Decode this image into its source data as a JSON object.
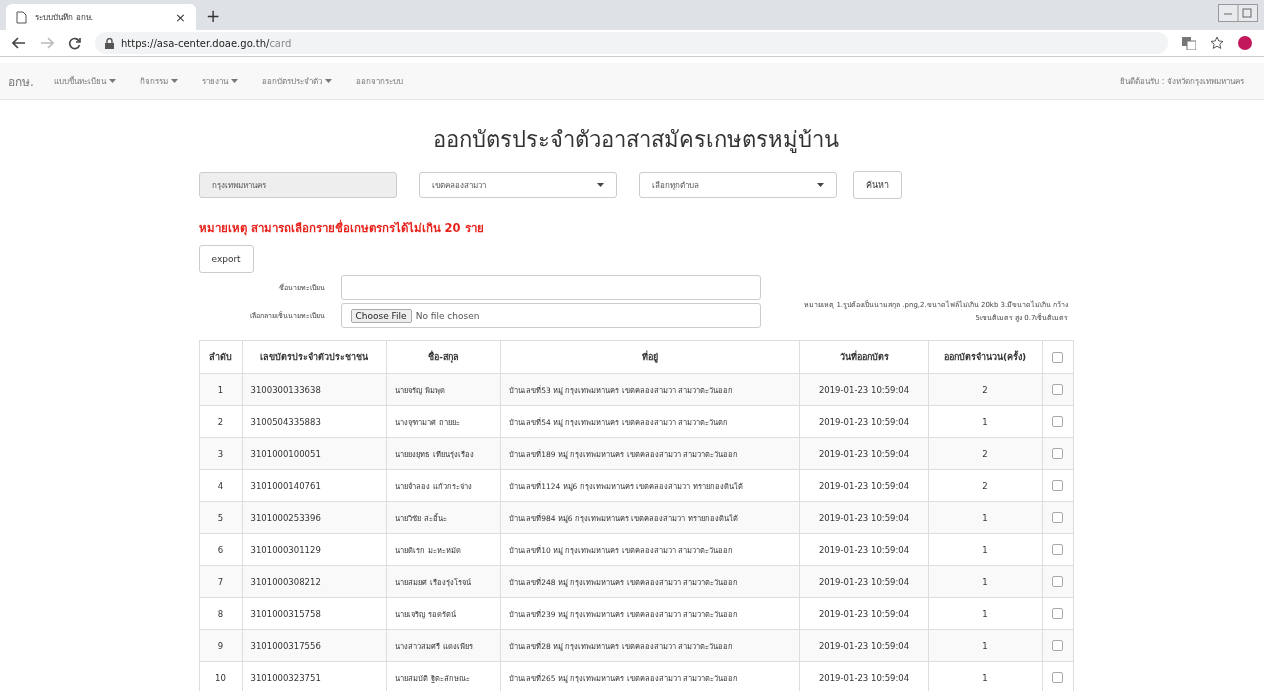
{
  "browser": {
    "tab_title": "ระบบบันทึก อกษ.",
    "tab_close": "×",
    "new_tab": "+",
    "url_host": "https://asa-center.doae.go.th/",
    "url_path": "card"
  },
  "navbar": {
    "brand": "อกษ.",
    "items": [
      {
        "label": "แบบขึ้นทะเบียน",
        "dropdown": true
      },
      {
        "label": "กิจกรรม",
        "dropdown": true
      },
      {
        "label": "รายงาน",
        "dropdown": true
      },
      {
        "label": "ออกบัตรประจำตัว",
        "dropdown": true
      },
      {
        "label": "ออกจากระบบ",
        "dropdown": false
      }
    ],
    "welcome": "ยินดีต้อนรับ : จังหวัดกรุงเทพมหานคร"
  },
  "title": "ออกบัตรประจำตัวอาสาสมัครเกษตรหมู่บ้าน",
  "filters": [
    {
      "kind": "text",
      "value": "กรุงเทพมหานคร",
      "disabled": true
    },
    {
      "kind": "select",
      "value": "เขตคลองสามวา",
      "disabled": false
    },
    {
      "kind": "select",
      "value": "เลือกทุกตำบล",
      "disabled": false
    }
  ],
  "search_button": "ค้นหา",
  "warning": "หมายเหตุ สามารถเลือกรายชื่อเกษตรกรได้ไม่เกิน 20 ราย",
  "export_button": "export",
  "registrar_name_label": "ชื่อนายทะเบียน",
  "signature_label": "เลือกลายเซ็นนายทะเบียน",
  "file_button": "Choose File",
  "file_status": "No file chosen",
  "file_note": "หมายเหตุ 1.รูปต้องเป็นนามสกุล .png,2.ขนาดไฟล์ไม่เกิน 20kb 3.มีขนาดไม่เกิน กว้าง 5เซนติเมตร สูง 0.7เซ็นติเมตร",
  "table": {
    "columns": [
      "ลำดับ",
      "เลขบัตรประจำตัวประชาชน",
      "ชื่อ-สกุล",
      "ที่อยู่",
      "วันที่ออกบัตร",
      "ออกบัตรจำนวน(ครั้ง)"
    ],
    "select_all_checked": false,
    "rows": [
      {
        "no": "1",
        "id": "3100300133638",
        "name": "นายจรัญ พิมพุด",
        "address": "บ้านเลขที่53 หมู่ กรุงเทพมหานคร เขตคลองสามวา สามวาตะวันออก",
        "date": "2019-01-23 10:59:04",
        "count": "2",
        "checked": false
      },
      {
        "no": "2",
        "id": "3100504335883",
        "name": "นางจุฑามาศ ถายยะ",
        "address": "บ้านเลขที่54 หมู่ กรุงเทพมหานคร เขตคลองสามวา สามวาตะวันตก",
        "date": "2019-01-23 10:59:04",
        "count": "1",
        "checked": false
      },
      {
        "no": "3",
        "id": "3101000100051",
        "name": "นายยงยุทธ เทียนรุ่งเรือง",
        "address": "บ้านเลขที่189 หมู่ กรุงเทพมหานคร เขตคลองสามวา สามวาตะวันออก",
        "date": "2019-01-23 10:59:04",
        "count": "2",
        "checked": false
      },
      {
        "no": "4",
        "id": "3101000140761",
        "name": "นายจำลอง แก้วกระจ่าง",
        "address": "บ้านเลขที่1124 หมู่6 กรุงเทพมหานคร เขตคลองสามวา ทรายกองดินใต้",
        "date": "2019-01-23 10:59:04",
        "count": "2",
        "checked": false
      },
      {
        "no": "5",
        "id": "3101000253396",
        "name": "นายวิชัย สะอิ้นะ",
        "address": "บ้านเลขที่984 หมู่6 กรุงเทพมหานคร เขตคลองสามวา ทรายกองดินใต้",
        "date": "2019-01-23 10:59:04",
        "count": "1",
        "checked": false
      },
      {
        "no": "6",
        "id": "3101000301129",
        "name": "นายดิเรก มะหะหมัด",
        "address": "บ้านเลขที่10 หมู่ กรุงเทพมหานคร เขตคลองสามวา สามวาตะวันออก",
        "date": "2019-01-23 10:59:04",
        "count": "1",
        "checked": false
      },
      {
        "no": "7",
        "id": "3101000308212",
        "name": "นายสมยศ เรืองรุ่งโรจน์",
        "address": "บ้านเลขที่248 หมู่ กรุงเทพมหานคร เขตคลองสามวา สามวาตะวันออก",
        "date": "2019-01-23 10:59:04",
        "count": "1",
        "checked": false
      },
      {
        "no": "8",
        "id": "3101000315758",
        "name": "นายเจริญ รอดรัตน์",
        "address": "บ้านเลขที่239 หมู่ กรุงเทพมหานคร เขตคลองสามวา สามวาตะวันออก",
        "date": "2019-01-23 10:59:04",
        "count": "1",
        "checked": false
      },
      {
        "no": "9",
        "id": "3101000317556",
        "name": "นางสาวสมศรี แดงเพียร",
        "address": "บ้านเลขที่28 หมู่ กรุงเทพมหานคร เขตคลองสามวา สามวาตะวันออก",
        "date": "2019-01-23 10:59:04",
        "count": "1",
        "checked": false
      },
      {
        "no": "10",
        "id": "3101000323751",
        "name": "นายสมบัติ ฐิตะลักษณะ",
        "address": "บ้านเลขที่265 หมู่ กรุงเทพมหานคร เขตคลองสามวา สามวาตะวันออก",
        "date": "2019-01-23 10:59:04",
        "count": "1",
        "checked": false
      }
    ]
  }
}
